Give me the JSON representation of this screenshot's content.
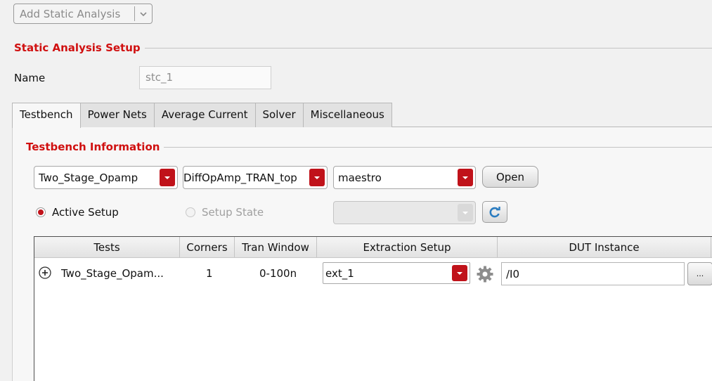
{
  "toolbar": {
    "add_label": "Add Static Analysis"
  },
  "setup": {
    "title": "Static Analysis Setup",
    "name_label": "Name",
    "name_value": "stc_1"
  },
  "tabs": [
    {
      "label": "Testbench",
      "active": true
    },
    {
      "label": "Power Nets",
      "active": false
    },
    {
      "label": "Average Current",
      "active": false
    },
    {
      "label": "Solver",
      "active": false
    },
    {
      "label": "Miscellaneous",
      "active": false
    }
  ],
  "testbench": {
    "title": "Testbench Information",
    "library": "Two_Stage_Opamp",
    "cell": "DiffOpAmp_TRAN_top",
    "view": "maestro",
    "open_label": "Open",
    "active_setup_label": "Active Setup",
    "setup_state_label": "Setup State",
    "setup_state_value": ""
  },
  "table": {
    "columns": [
      "Tests",
      "Corners",
      "Tran Window",
      "Extraction Setup",
      "DUT Instance"
    ],
    "rows": [
      {
        "test": "Two_Stage_Opam...",
        "corners": "1",
        "tran_window": "0-100n",
        "extraction_setup": "ext_1",
        "dut_instance": "/I0",
        "browse_label": "..."
      }
    ]
  },
  "colors": {
    "accent": "#c0121a",
    "section_title": "#d01010"
  }
}
